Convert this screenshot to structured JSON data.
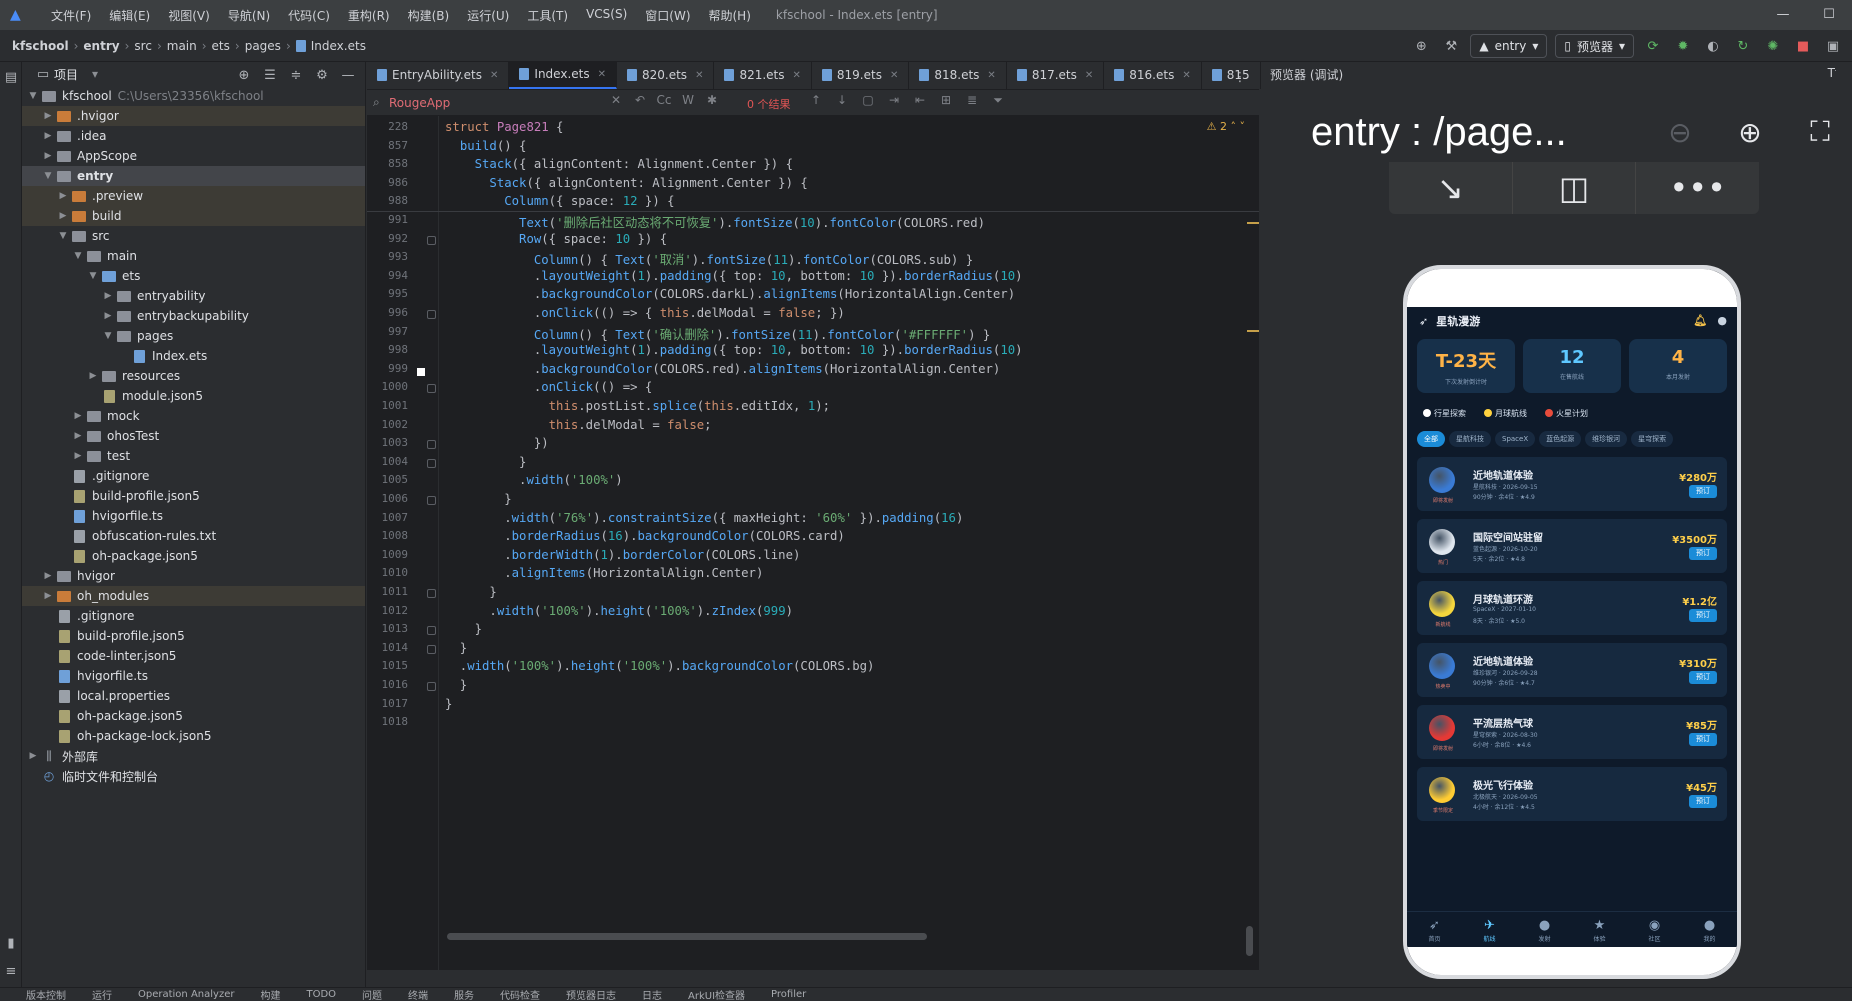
{
  "menu": {
    "items": [
      "文件(F)",
      "编辑(E)",
      "视图(V)",
      "导航(N)",
      "代码(C)",
      "重构(R)",
      "构建(B)",
      "运行(U)",
      "工具(T)",
      "VCS(S)",
      "窗口(W)",
      "帮助(H)"
    ],
    "window_title": "kfschool - Index.ets [entry]"
  },
  "breadcrumbs": [
    "kfschool",
    "entry",
    "src",
    "main",
    "ets",
    "pages",
    "Index.ets"
  ],
  "toolbar": {
    "run_config": "entry",
    "device": "预览器"
  },
  "project_panel": {
    "title": "项目",
    "tree": [
      {
        "label": "kfschool",
        "sub": "C:\\Users\\23356\\kfschool",
        "depth": 0,
        "arrow": "open",
        "icon": "folder"
      },
      {
        "label": ".hvigor",
        "depth": 1,
        "arrow": "closed",
        "icon": "folder-excl",
        "hl": true
      },
      {
        "label": ".idea",
        "depth": 1,
        "arrow": "closed",
        "icon": "folder"
      },
      {
        "label": "AppScope",
        "depth": 1,
        "arrow": "closed",
        "icon": "folder"
      },
      {
        "label": "entry",
        "depth": 1,
        "arrow": "open",
        "icon": "folder",
        "bold": true,
        "sel": true
      },
      {
        "label": ".preview",
        "depth": 2,
        "arrow": "closed",
        "icon": "folder-excl",
        "hl": true
      },
      {
        "label": "build",
        "depth": 2,
        "arrow": "closed",
        "icon": "folder-excl",
        "hl": true
      },
      {
        "label": "src",
        "depth": 2,
        "arrow": "open",
        "icon": "folder"
      },
      {
        "label": "main",
        "depth": 3,
        "arrow": "open",
        "icon": "folder"
      },
      {
        "label": "ets",
        "depth": 4,
        "arrow": "open",
        "icon": "folder-blue"
      },
      {
        "label": "entryability",
        "depth": 5,
        "arrow": "closed",
        "icon": "folder"
      },
      {
        "label": "entrybackupability",
        "depth": 5,
        "arrow": "closed",
        "icon": "folder"
      },
      {
        "label": "pages",
        "depth": 5,
        "arrow": "open",
        "icon": "folder"
      },
      {
        "label": "Index.ets",
        "depth": 6,
        "arrow": "none",
        "icon": "file-ets"
      },
      {
        "label": "resources",
        "depth": 4,
        "arrow": "closed",
        "icon": "folder"
      },
      {
        "label": "module.json5",
        "depth": 4,
        "arrow": "none",
        "icon": "file-json"
      },
      {
        "label": "mock",
        "depth": 3,
        "arrow": "closed",
        "icon": "folder"
      },
      {
        "label": "ohosTest",
        "depth": 3,
        "arrow": "closed",
        "icon": "folder"
      },
      {
        "label": "test",
        "depth": 3,
        "arrow": "closed",
        "icon": "folder"
      },
      {
        "label": ".gitignore",
        "depth": 2,
        "arrow": "none",
        "icon": "file"
      },
      {
        "label": "build-profile.json5",
        "depth": 2,
        "arrow": "none",
        "icon": "file-json"
      },
      {
        "label": "hvigorfile.ts",
        "depth": 2,
        "arrow": "none",
        "icon": "file-ets"
      },
      {
        "label": "obfuscation-rules.txt",
        "depth": 2,
        "arrow": "none",
        "icon": "file"
      },
      {
        "label": "oh-package.json5",
        "depth": 2,
        "arrow": "none",
        "icon": "file-json"
      },
      {
        "label": "hvigor",
        "depth": 1,
        "arrow": "closed",
        "icon": "folder"
      },
      {
        "label": "oh_modules",
        "depth": 1,
        "arrow": "closed",
        "icon": "folder-excl",
        "hl": true
      },
      {
        "label": ".gitignore",
        "depth": 1,
        "arrow": "none",
        "icon": "file"
      },
      {
        "label": "build-profile.json5",
        "depth": 1,
        "arrow": "none",
        "icon": "file-json"
      },
      {
        "label": "code-linter.json5",
        "depth": 1,
        "arrow": "none",
        "icon": "file-json"
      },
      {
        "label": "hvigorfile.ts",
        "depth": 1,
        "arrow": "none",
        "icon": "file-ets"
      },
      {
        "label": "local.properties",
        "depth": 1,
        "arrow": "none",
        "icon": "file"
      },
      {
        "label": "oh-package.json5",
        "depth": 1,
        "arrow": "none",
        "icon": "file-json"
      },
      {
        "label": "oh-package-lock.json5",
        "depth": 1,
        "arrow": "none",
        "icon": "file-json"
      },
      {
        "label": "外部库",
        "depth": 0,
        "arrow": "closed",
        "icon": "lib"
      },
      {
        "label": "临时文件和控制台",
        "depth": 0,
        "arrow": "none",
        "icon": "scratch"
      }
    ]
  },
  "tabs": [
    {
      "label": "EntryAbility.ets",
      "active": false
    },
    {
      "label": "Index.ets",
      "active": true
    },
    {
      "label": "820.ets",
      "active": false
    },
    {
      "label": "821.ets",
      "active": false
    },
    {
      "label": "819.ets",
      "active": false
    },
    {
      "label": "818.ets",
      "active": false
    },
    {
      "label": "817.ets",
      "active": false
    },
    {
      "label": "816.ets",
      "active": false
    },
    {
      "label": "815",
      "active": false
    }
  ],
  "findbar": {
    "query": "RougeApp",
    "result": "0 个结果"
  },
  "editor": {
    "warnings": "2",
    "lines": [
      {
        "n": "228",
        "t": "<span class='kw'>struct</span> <span class='cls'>Page821</span> {"
      },
      {
        "n": "857",
        "t": "  <span class='fn'>build</span>() {"
      },
      {
        "n": "858",
        "t": "    <span class='fn'>Stack</span>({ alignContent: Alignment.Center }) {"
      },
      {
        "n": "986",
        "t": "      <span class='fn'>Stack</span>({ alignContent: Alignment.Center }) {"
      },
      {
        "n": "988",
        "t": "        <span class='fn'>Column</span>({ space: <span class='num'>12</span> }) {"
      },
      {
        "n": "991",
        "t": "          <span class='fn'>Text</span>(<span class='str'>'删除后社区动态将不可恢复'</span>).<span class='fn'>fontSize</span>(<span class='num'>10</span>).<span class='fn'>fontColor</span>(COLORS.red)"
      },
      {
        "n": "992",
        "t": "          <span class='fn'>Row</span>({ space: <span class='num'>10</span> }) {"
      },
      {
        "n": "993",
        "t": "            <span class='fn'>Column</span>() { <span class='fn'>Text</span>(<span class='str'>'取消'</span>).<span class='fn'>fontSize</span>(<span class='num'>11</span>).<span class='fn'>fontColor</span>(COLORS.sub) }"
      },
      {
        "n": "994",
        "t": "            .<span class='fn'>layoutWeight</span>(<span class='num'>1</span>).<span class='fn'>padding</span>({ top: <span class='num'>10</span>, bottom: <span class='num'>10</span> }).<span class='fn'>borderRadius</span>(<span class='num'>10</span>)"
      },
      {
        "n": "995",
        "t": "            .<span class='fn'>backgroundColor</span>(COLORS.darkL).<span class='fn'>alignItems</span>(HorizontalAlign.Center)"
      },
      {
        "n": "996",
        "t": "            .<span class='fn'>onClick</span>(() => { <span class='kw'>this</span>.delModal = <span class='kw'>false</span>; })"
      },
      {
        "n": "997",
        "t": "            <span class='fn'>Column</span>() { <span class='fn'>Text</span>(<span class='str'>'确认删除'</span>).<span class='fn'>fontSize</span>(<span class='num'>11</span>).<span class='fn'>fontColor</span>(<span class='str'>'#FFFFFF'</span>) }"
      },
      {
        "n": "998",
        "t": "            .<span class='fn'>layoutWeight</span>(<span class='num'>1</span>).<span class='fn'>padding</span>({ top: <span class='num'>10</span>, bottom: <span class='num'>10</span> }).<span class='fn'>borderRadius</span>(<span class='num'>10</span>)"
      },
      {
        "n": "999",
        "t": "            .<span class='fn'>backgroundColor</span>(COLORS.red).<span class='fn'>alignItems</span>(HorizontalAlign.Center)"
      },
      {
        "n": "1000",
        "t": "            .<span class='fn'>onClick</span>(() => {"
      },
      {
        "n": "1001",
        "t": "              <span class='kw'>this</span>.postList.<span class='fn'>splice</span>(<span class='kw'>this</span>.editIdx, <span class='num'>1</span>);"
      },
      {
        "n": "1002",
        "t": "              <span class='kw'>this</span>.delModal = <span class='kw'>false</span>;"
      },
      {
        "n": "1003",
        "t": "            })"
      },
      {
        "n": "1004",
        "t": "          }"
      },
      {
        "n": "1005",
        "t": "          .<span class='fn'>width</span>(<span class='str'>'100%'</span>)"
      },
      {
        "n": "1006",
        "t": "        }"
      },
      {
        "n": "1007",
        "t": "        .<span class='fn'>width</span>(<span class='str'>'76%'</span>).<span class='fn'>constraintSize</span>({ maxHeight: <span class='str'>'60%'</span> }).<span class='fn'>padding</span>(<span class='num'>16</span>)"
      },
      {
        "n": "1008",
        "t": "        .<span class='fn'>borderRadius</span>(<span class='num'>16</span>).<span class='fn'>backgroundColor</span>(COLORS.card)"
      },
      {
        "n": "1009",
        "t": "        .<span class='fn'>borderWidth</span>(<span class='num'>1</span>).<span class='fn'>borderColor</span>(COLORS.line)"
      },
      {
        "n": "1010",
        "t": "        .<span class='fn'>alignItems</span>(HorizontalAlign.Center)"
      },
      {
        "n": "1011",
        "t": "      }"
      },
      {
        "n": "1012",
        "t": "      .<span class='fn'>width</span>(<span class='str'>'100%'</span>).<span class='fn'>height</span>(<span class='str'>'100%'</span>).<span class='fn'>zIndex</span>(<span class='num'>999</span>)"
      },
      {
        "n": "1013",
        "t": "    }"
      },
      {
        "n": "1014",
        "t": "  }"
      },
      {
        "n": "1015",
        "t": "  .<span class='fn'>width</span>(<span class='str'>'100%'</span>).<span class='fn'>height</span>(<span class='str'>'100%'</span>).<span class='fn'>backgroundColor</span>(COLORS.bg)"
      },
      {
        "n": "1016",
        "t": "  }"
      },
      {
        "n": "1017",
        "t": "}"
      },
      {
        "n": "1018",
        "t": ""
      }
    ]
  },
  "preview": {
    "panel_title": "预览器 (调试)",
    "page_title": "entry : /page...",
    "app": {
      "title": "星轨漫游",
      "stats": [
        {
          "value": "T-23天",
          "label": "下次发射倒计时",
          "orange": true
        },
        {
          "value": "12",
          "label": "在售航线",
          "orange": false
        },
        {
          "value": "4",
          "label": "本月发射",
          "orange": true
        }
      ],
      "chips": [
        {
          "label": "行星探索",
          "color": "#ffffff"
        },
        {
          "label": "月球航线",
          "color": "#ffd23f"
        },
        {
          "label": "火星计划",
          "color": "#e74c3c"
        }
      ],
      "filters": [
        "全部",
        "星航科技",
        "SpaceX",
        "蓝色起源",
        "维珍银河",
        "星穹探索"
      ],
      "cards": [
        {
          "title": "近地轨道体验",
          "sub": "星航科技 · 2026-09-15",
          "meta": "90分钟 · 余4位 · ★4.9",
          "price": "¥280万",
          "btn": "预订",
          "tag": "即将发射",
          "color": "#3a7bd5"
        },
        {
          "title": "国际空间站驻留",
          "sub": "蓝色起源 · 2026-10-20",
          "meta": "5天 · 余2位 · ★4.8",
          "price": "¥3500万",
          "btn": "预订",
          "tag": "热门",
          "color": "#dfe6ee"
        },
        {
          "title": "月球轨道环游",
          "sub": "SpaceX · 2027-01-10",
          "meta": "8天 · 余3位 · ★5.0",
          "price": "¥1.2亿",
          "btn": "预订",
          "tag": "新航线",
          "color": "#f5d63d"
        },
        {
          "title": "近地轨道体验",
          "sub": "维珍银河 · 2026-09-28",
          "meta": "90分钟 · 余6位 · ★4.7",
          "price": "¥310万",
          "btn": "预订",
          "tag": "热卖中",
          "color": "#3a7bd5"
        },
        {
          "title": "平流层热气球",
          "sub": "星穹探索 · 2026-08-30",
          "meta": "6小时 · 余8位 · ★4.6",
          "price": "¥85万",
          "btn": "预订",
          "tag": "即将发射",
          "color": "#e53935"
        },
        {
          "title": "极光飞行体验",
          "sub": "北极航天 · 2026-09-05",
          "meta": "4小时 · 余12位 · ★4.5",
          "price": "¥45万",
          "btn": "预订",
          "tag": "季节限定",
          "color": "#ffcc33"
        }
      ],
      "tabbar": [
        "首页",
        "航线",
        "发射",
        "体验",
        "社区",
        "我的"
      ]
    }
  },
  "statusbar": [
    "版本控制",
    "运行",
    "Operation Analyzer",
    "构建",
    "TODO",
    "问题",
    "终端",
    "服务",
    "代码检查",
    "预览器日志",
    "日志",
    "ArkUI检查器",
    "Profiler"
  ]
}
